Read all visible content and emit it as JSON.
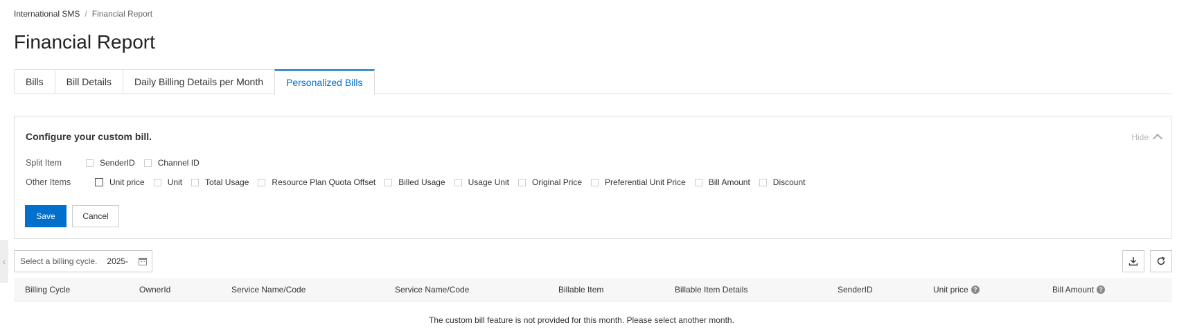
{
  "breadcrumb": {
    "root": "International SMS",
    "separator": "/",
    "current": "Financial Report"
  },
  "page_title": "Financial Report",
  "tabs": [
    {
      "label": "Bills",
      "active": false
    },
    {
      "label": "Bill Details",
      "active": false
    },
    {
      "label": "Daily Billing Details per Month",
      "active": false
    },
    {
      "label": "Personalized Bills",
      "active": true
    }
  ],
  "config": {
    "title": "Configure your custom bill.",
    "hide_label": "Hide",
    "split_label": "Split Item",
    "split_items": [
      "SenderID",
      "Channel ID"
    ],
    "other_label": "Other Items",
    "other_items": [
      "Unit price",
      "Unit",
      "Total Usage",
      "Resource Plan Quota Offset",
      "Billed Usage",
      "Usage Unit",
      "Original Price",
      "Preferential Unit Price",
      "Bill Amount",
      "Discount"
    ],
    "save_label": "Save",
    "cancel_label": "Cancel"
  },
  "cycle": {
    "label": "Select a billing cycle.",
    "value": "2025-"
  },
  "table": {
    "columns": [
      "Billing Cycle",
      "OwnerId",
      "Service Name/Code",
      "Service Name/Code",
      "Billable Item",
      "Billable Item Details",
      "SenderID",
      "Unit price",
      "Bill Amount"
    ],
    "help_icon": "?",
    "empty_message": "The custom bill feature is not provided for this month. Please select another month."
  },
  "colors": {
    "accent": "#0070cc"
  }
}
